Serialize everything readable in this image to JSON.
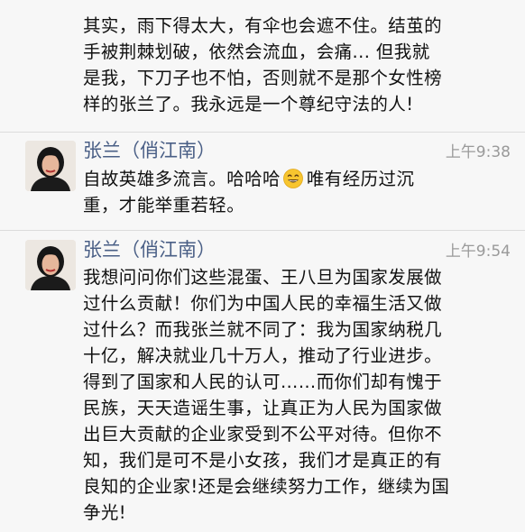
{
  "top_message": {
    "lines": [
      "其实，雨下得太大，有伞也会遮不住。结茧的",
      "手被荆棘划破，依然会流血，会痛... 但我就",
      "是我，下刀子也不怕，否则就不是那个女性榜",
      "样的张兰了。我永远是一个尊纪守法的人!"
    ]
  },
  "messages": [
    {
      "author": "张兰（俏江南）",
      "time": "上午9:38",
      "text_before_emoji": "自故英雄多流言。哈哈哈",
      "emoji": "smiling-face-emoji",
      "text_after_emoji": "唯有经历过沉",
      "line2": "重，才能举重若轻。"
    },
    {
      "author": "张兰（俏江南）",
      "time": "上午9:54",
      "lines": [
        "我想问问你们这些混蛋、王八旦为国家发展做",
        "过什么贡献！你们为中国人民的幸福生活又做",
        "过什么？而我张兰就不同了：我为国家纳税几",
        "十亿，解决就业几十万人，推动了行业进步。",
        "得到了国家和人民的认可……而你们却有愧于",
        "民族，天天造谣生事，让真正为人民为国家做",
        "出巨大贡献的企业家受到不公平对待。但你不",
        "知，我们是可不是小女孩，我们才是真正的有",
        "良知的企业家!还是会继续努力工作，继续为国",
        "争光!"
      ]
    }
  ],
  "colors": {
    "background": "#f7f7f7",
    "author_name": "#4a5f86",
    "timestamp": "#9a9a9a",
    "divider": "#dcdcdc"
  }
}
